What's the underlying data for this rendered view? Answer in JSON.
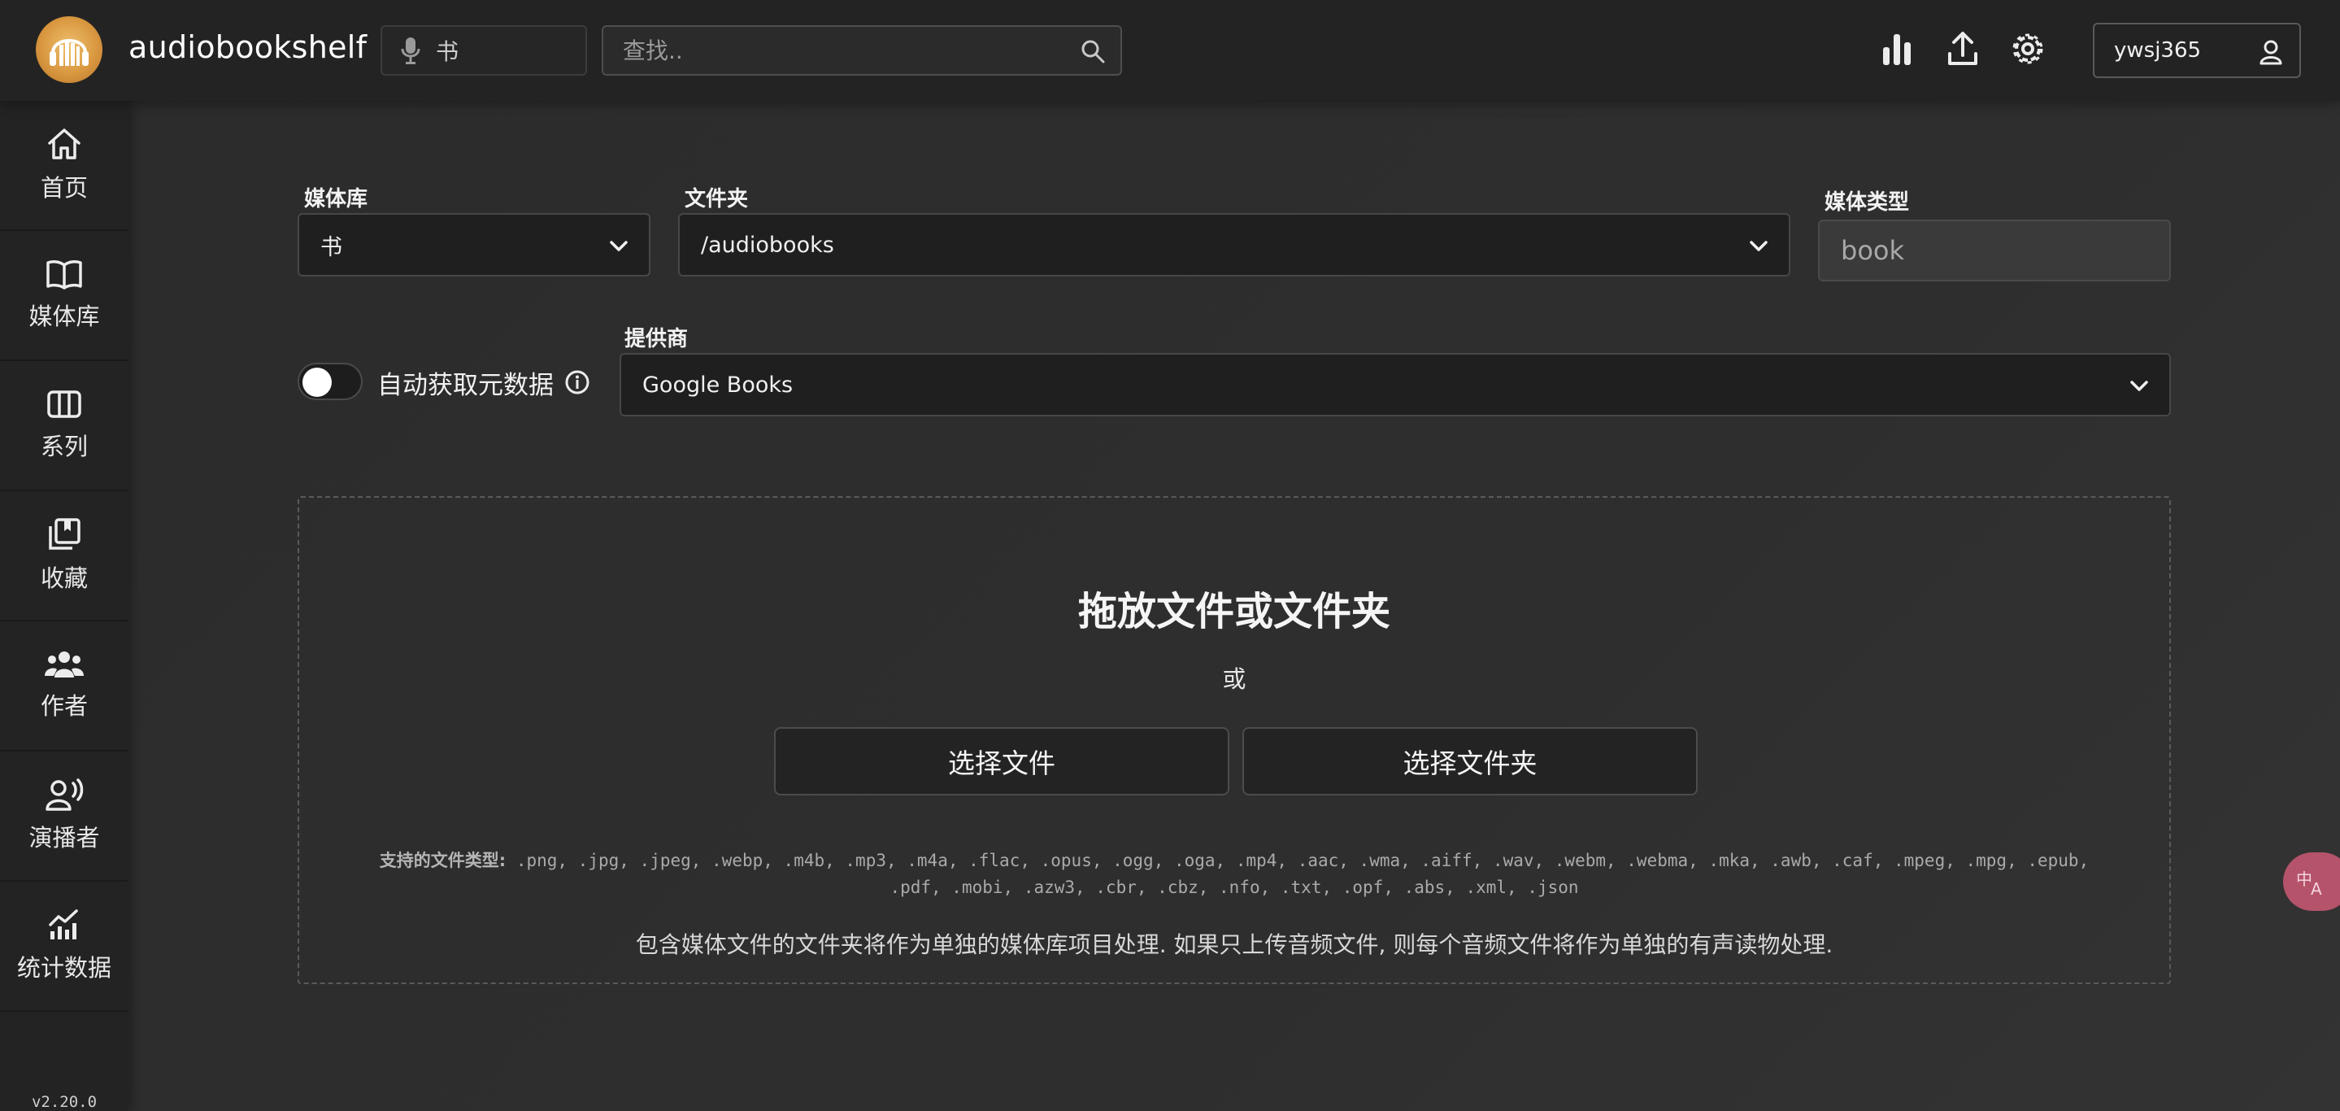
{
  "header": {
    "app_title": "audiobookshelf",
    "library_selector": {
      "icon": "microphone-icon",
      "value": "书"
    },
    "search": {
      "placeholder": "查找.."
    },
    "actions": [
      "stats-icon",
      "upload-icon",
      "settings-icon"
    ],
    "user": {
      "name": "ywsj365",
      "icon": "user-icon"
    }
  },
  "sidebar": {
    "items": [
      {
        "label": "首页",
        "icon": "home-icon"
      },
      {
        "label": "媒体库",
        "icon": "book-icon"
      },
      {
        "label": "系列",
        "icon": "series-icon"
      },
      {
        "label": "收藏",
        "icon": "collections-icon"
      },
      {
        "label": "作者",
        "icon": "authors-icon"
      },
      {
        "label": "演播者",
        "icon": "narrator-icon"
      },
      {
        "label": "统计数据",
        "icon": "stats-chart-icon"
      }
    ],
    "version": "v2.20.0"
  },
  "form": {
    "library": {
      "label": "媒体库",
      "value": "书"
    },
    "folder": {
      "label": "文件夹",
      "value": "/audiobooks"
    },
    "media_type": {
      "label": "媒体类型",
      "value": "book"
    },
    "auto_fetch": {
      "label": "自动获取元数据",
      "enabled": false
    },
    "provider": {
      "label": "提供商",
      "value": "Google Books"
    }
  },
  "dropzone": {
    "title": "拖放文件或文件夹",
    "or_text": "或",
    "choose_files": "选择文件",
    "choose_folder": "选择文件夹",
    "supported_label": "支持的文件类型:",
    "supported_types": ".png, .jpg, .jpeg, .webp, .m4b, .mp3, .m4a, .flac, .opus, .ogg, .oga, .mp4, .aac, .wma, .aiff, .wav, .webm, .webma, .mka, .awb, .caf, .mpeg, .mpg, .epub, .pdf, .mobi, .azw3, .cbr, .cbz, .nfo, .txt, .opf, .abs, .xml, .json",
    "note": "包含媒体文件的文件夹将作为单独的媒体库项目处理. 如果只上传音频文件, 则每个音频文件将作为单独的有声读物处理."
  },
  "colors": {
    "background": "#2a2a2a",
    "topbar": "#232323",
    "logo": "#d99840",
    "translate_fab": "#b5536b"
  }
}
